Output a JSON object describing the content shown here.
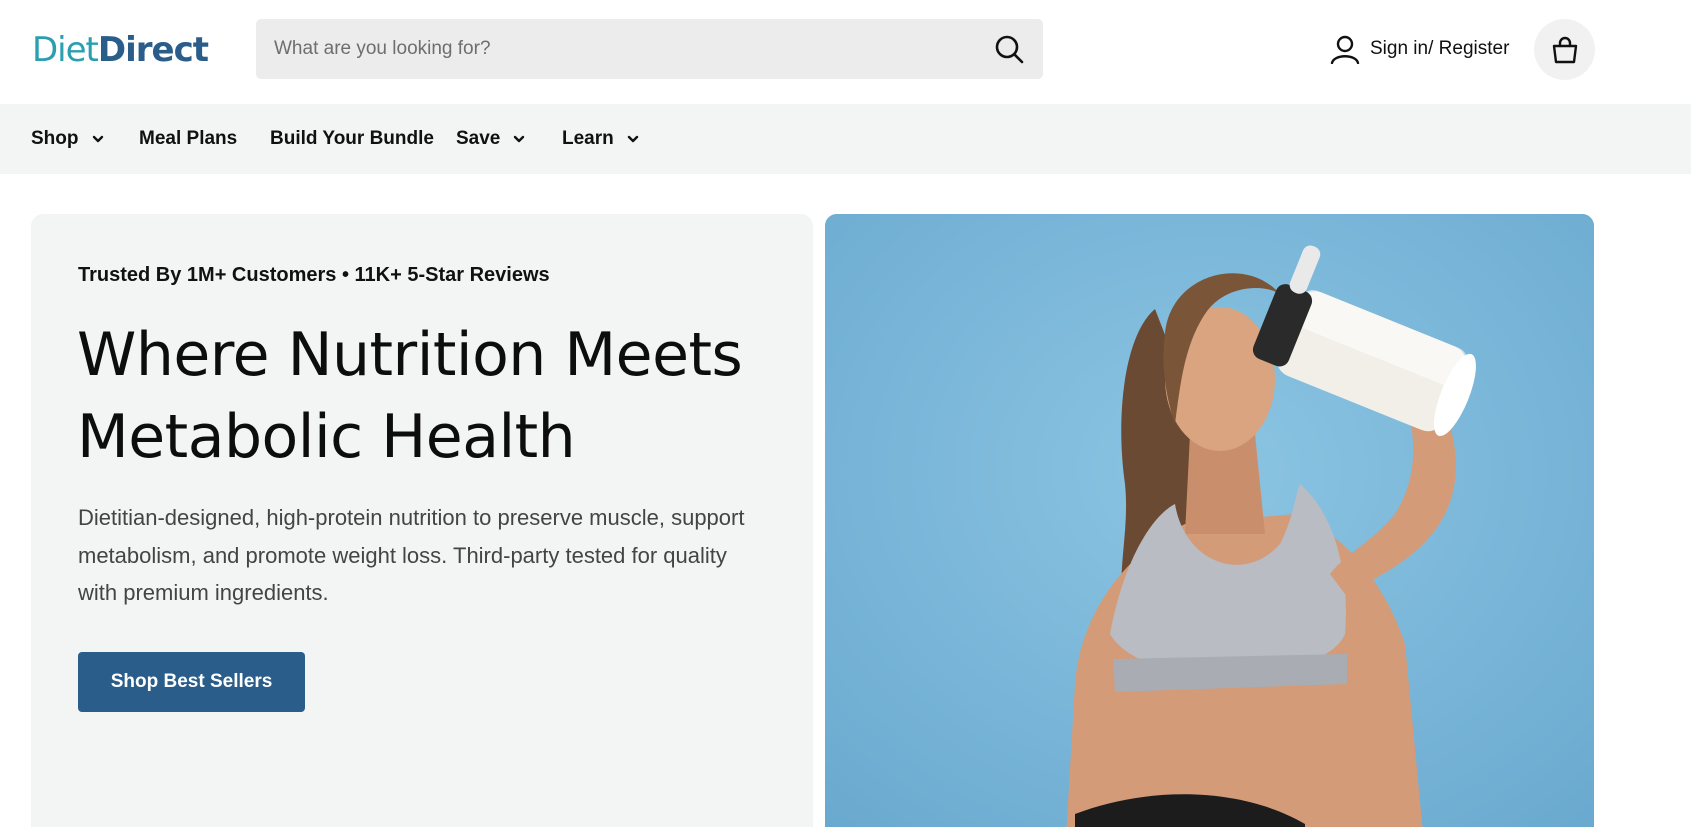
{
  "header": {
    "logo_part1": "Diet",
    "logo_part2": "Direct",
    "search_placeholder": "What are you looking for?",
    "signin_label": "Sign in/ Register"
  },
  "nav": {
    "items": [
      {
        "label": "Shop",
        "has_dropdown": true
      },
      {
        "label": "Meal Plans",
        "has_dropdown": false
      },
      {
        "label": "Build Your Bundle",
        "has_dropdown": false
      },
      {
        "label": "Save",
        "has_dropdown": true
      },
      {
        "label": "Learn",
        "has_dropdown": true
      }
    ]
  },
  "hero": {
    "trust_line": "Trusted By 1M+ Customers • 11K+ 5-Star Reviews",
    "headline_line1": "Where Nutrition Meets",
    "headline_line2": "Metabolic Health",
    "description": "Dietitian-designed, high-protein nutrition to preserve muscle, support metabolism, and promote weight loss. Third-party tested for quality with premium ingredients.",
    "cta_label": "Shop Best Sellers"
  },
  "colors": {
    "brand_teal": "#2a9fb0",
    "brand_blue": "#2a5d8a",
    "nav_bg": "#f3f5f4",
    "hero_image_bg": "#79b7d8"
  },
  "icons": [
    "search-icon",
    "user-icon",
    "shopping-bag-icon",
    "chevron-down-icon"
  ]
}
